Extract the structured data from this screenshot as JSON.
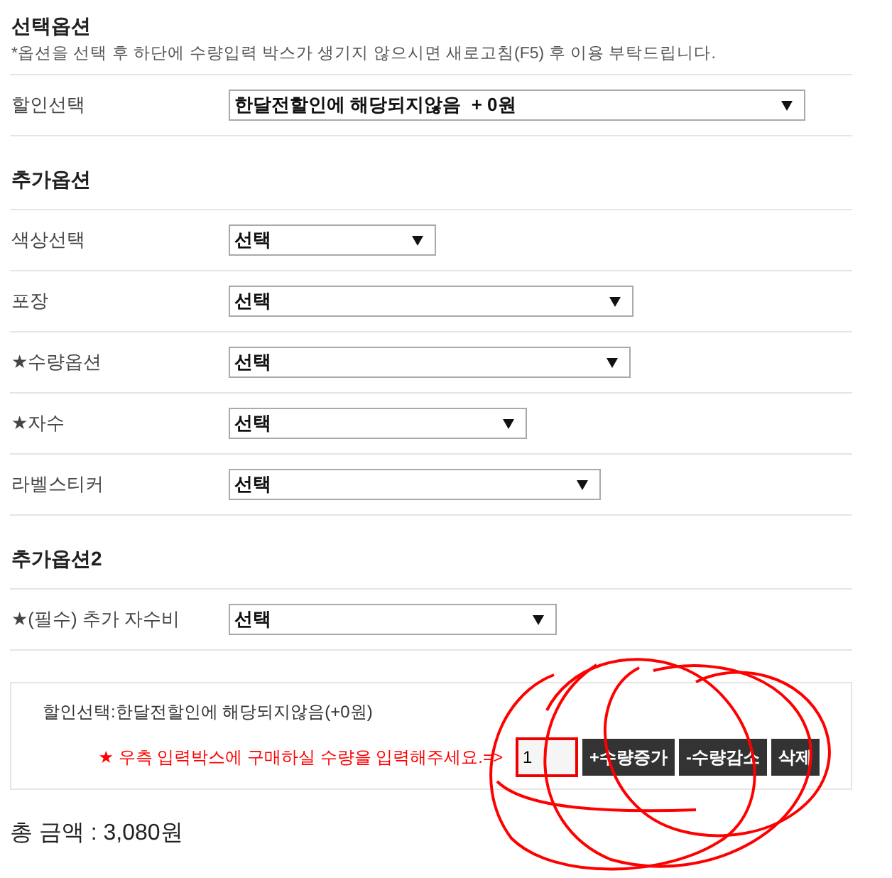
{
  "sections": [
    {
      "heading": "선택옵션",
      "notice": "*옵션을 선택 후 하단에 수량입력 박스가 생기지 않으시면 새로고침(F5) 후 이용 부탁드립니다.",
      "rows": [
        {
          "label": "할인선택",
          "value": "한달전할인에 해당되지않음  + 0원"
        }
      ]
    },
    {
      "heading": "추가옵션",
      "rows": [
        {
          "label": "색상선택",
          "value": "선택"
        },
        {
          "label": "포장",
          "value": "선택"
        },
        {
          "label": "★수량옵션",
          "value": "선택"
        },
        {
          "label": "★자수",
          "value": "선택"
        },
        {
          "label": "라벨스티커",
          "value": "선택"
        }
      ]
    },
    {
      "heading": "추가옵션2",
      "rows": [
        {
          "label": "★(필수) 추가 자수비",
          "value": "선택"
        }
      ]
    }
  ],
  "summary": {
    "selected_option": "할인선택:한달전할인에 해당되지않음(+0원)",
    "instruction": "★ 우측 입력박스에 구매하실 수량을 입력해주세요.=>",
    "quantity": "1",
    "buttons": [
      "+수량증가",
      "-수량감소",
      "삭제"
    ]
  },
  "total": "총 금액 : 3,080원"
}
